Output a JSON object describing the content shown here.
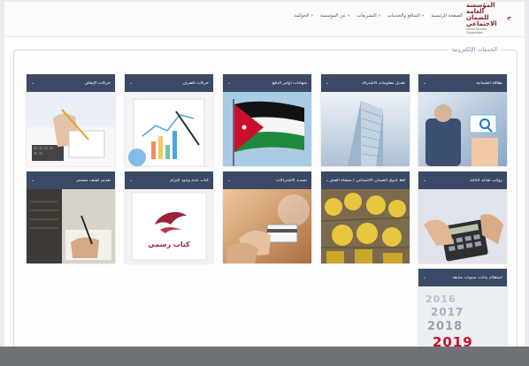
{
  "header": {
    "top_text": "",
    "nav": [
      {
        "label": "الصفحة الرئيسية"
      },
      {
        "label": "المنافع والخدمات"
      },
      {
        "label": "التشريعات"
      },
      {
        "label": "عن المؤسسة"
      },
      {
        "label": "الحوكمة"
      }
    ],
    "logo": {
      "arabic": "المؤسسة العامة للضمان الاجتماعي",
      "english": "Social Security Corporation"
    }
  },
  "services": {
    "title": "الخدمات الإلكترونية",
    "cards": [
      {
        "label": "بطاقة الضمانية"
      },
      {
        "label": "تعديل معلومات الاشتراك"
      },
      {
        "label": "شهادات أوامر الدفع"
      },
      {
        "label": "حركات الصرف"
      },
      {
        "label": "حركات الإيقاف"
      },
      {
        "label": "رواتب تقاعد الثالثة"
      },
      {
        "label": "خدمة الحافظ لذوي الضمان الاجتماعي / منشأة العمل"
      },
      {
        "label": "تسديد الاشتراكات"
      },
      {
        "label": "كتاب عدم وجود التزام"
      },
      {
        "label": "تقديم كشف مستمر"
      },
      {
        "label": "استعلام بيانات سنوات سابقة"
      }
    ],
    "card9_caption": "كتاب رسمي",
    "card11_years": [
      "2016",
      "2017",
      "2018",
      "2019"
    ]
  }
}
